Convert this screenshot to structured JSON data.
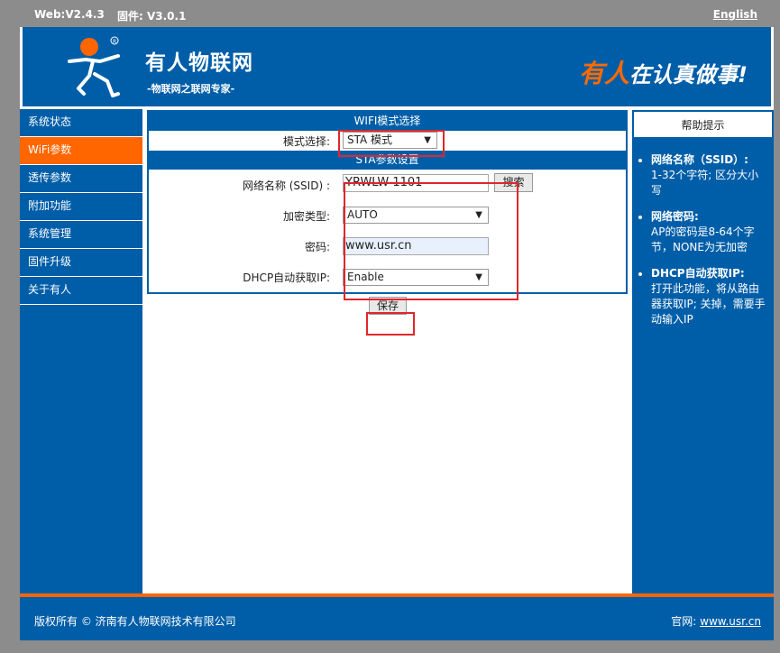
{
  "topbar": {
    "web_version": "Web:V2.4.3",
    "firmware_version": "固件: V3.0.1",
    "language_link": "English"
  },
  "header": {
    "brand_name": "有人物联网",
    "brand_tagline": "-物联网之联网专家-",
    "motto_highlight": "有人",
    "motto_rest": "在认真做事!"
  },
  "sidebar": {
    "items": [
      {
        "label": "系统状态",
        "active": false
      },
      {
        "label": "WiFi参数",
        "active": true
      },
      {
        "label": "透传参数",
        "active": false
      },
      {
        "label": "附加功能",
        "active": false
      },
      {
        "label": "系统管理",
        "active": false
      },
      {
        "label": "固件升级",
        "active": false
      },
      {
        "label": "关于有人",
        "active": false
      }
    ]
  },
  "wifi_mode": {
    "title": "WIFI模式选择",
    "mode_label": "模式选择:",
    "mode_value": "STA 模式"
  },
  "sta": {
    "title": "STA参数设置",
    "ssid_label": "网络名称 (SSID) :",
    "ssid_value": "YRWLW-1101",
    "search_button": "搜索",
    "encryption_label": "加密类型:",
    "encryption_value": "AUTO",
    "password_label": "密码:",
    "password_value": "www.usr.cn",
    "dhcp_label": "DHCP自动获取IP:",
    "dhcp_value": "Enable"
  },
  "save_button": "保存",
  "help": {
    "title": "帮助提示",
    "items": [
      {
        "heading": "网络名称（SSID）:",
        "text": "1-32个字符; 区分大小写"
      },
      {
        "heading": "网络密码:",
        "text": "AP的密码是8-64个字节，NONE为无加密"
      },
      {
        "heading": "DHCP自动获取IP:",
        "text": "打开此功能，将从路由器获取IP; 关掉，需要手动输入IP"
      }
    ]
  },
  "footer": {
    "copyright": "版权所有 © 济南有人物联网技术有限公司",
    "site_label": "官网:",
    "site_link": "www.usr.cn"
  },
  "colors": {
    "primary": "#005ea8",
    "accent": "#ff6600",
    "highlight_box": "#e0262a"
  }
}
